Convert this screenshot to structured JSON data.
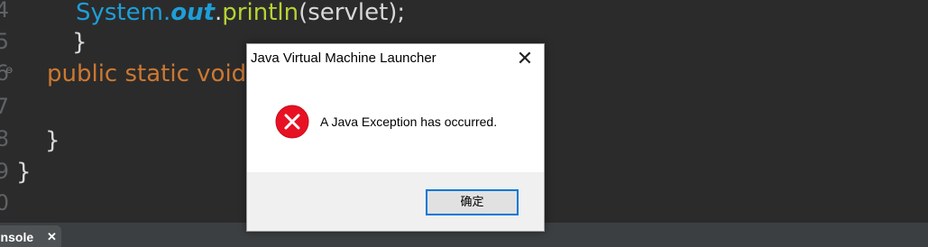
{
  "editor": {
    "line_numbers": [
      "4",
      "5",
      "6",
      "7",
      "8",
      "9",
      "0"
    ],
    "line1": {
      "class": "System.",
      "field": "out",
      "dot": ".",
      "method": "println",
      "rest": "(servlet);"
    },
    "line2": "}",
    "line3": "public static void",
    "line5": "}",
    "line6": "}"
  },
  "bottom_bar": {
    "console_tab_label": "onsole",
    "console_tab_close": "✕"
  },
  "dialog": {
    "title": "Java Virtual Machine Launcher",
    "close_glyph": "✕",
    "message": "A Java Exception has occurred.",
    "icon": "error-icon",
    "ok_label": "确定"
  },
  "colors": {
    "editor_bg": "#2b2b2b",
    "class_blue": "#1e9ed8",
    "method_green": "#b5d336",
    "keyword_orange": "#cc7832",
    "error_red": "#e81123",
    "button_focus_blue": "#0078d7"
  }
}
